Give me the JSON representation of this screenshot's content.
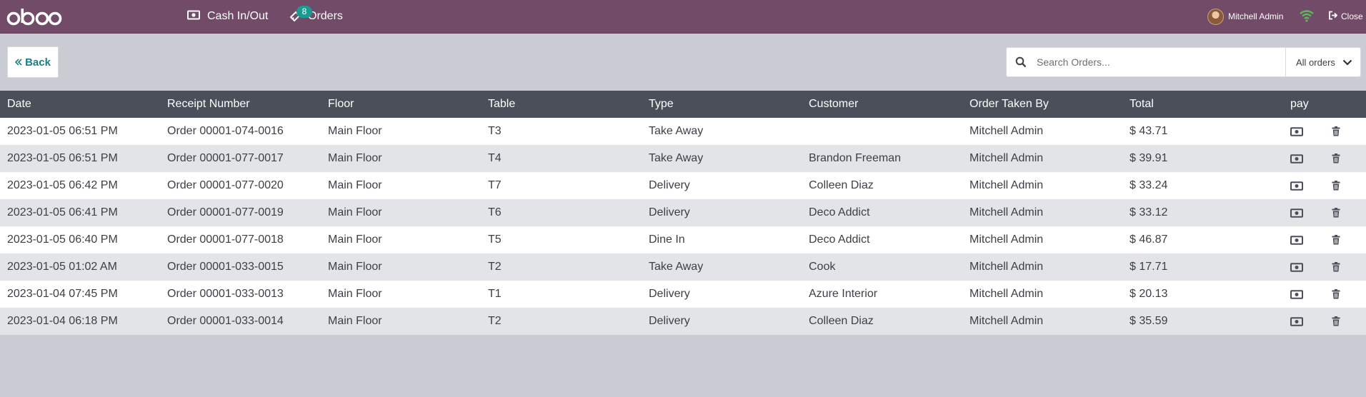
{
  "navbar": {
    "logo_text": "odoo",
    "cash_label": "Cash In/Out",
    "orders_label": "Orders",
    "orders_count": "8",
    "user_name": "Mitchell Admin",
    "close_label": "Close",
    "colors": {
      "background": "#714b67",
      "badge": "#1c9a8f",
      "wifi": "#5cb85c"
    }
  },
  "controls": {
    "back_label": "Back",
    "search_placeholder": "Search Orders...",
    "filter_label": "All orders"
  },
  "table": {
    "headers": [
      "Date",
      "Receipt Number",
      "Floor",
      "Table",
      "Type",
      "Customer",
      "Order Taken By",
      "Total",
      "pay"
    ],
    "rows": [
      {
        "date": "2023-01-05 06:51 PM",
        "receipt": "Order 00001-074-0016",
        "floor": "Main Floor",
        "table": "T3",
        "type": "Take Away",
        "customer": "",
        "taken_by": "Mitchell Admin",
        "total": "$ 43.71"
      },
      {
        "date": "2023-01-05 06:51 PM",
        "receipt": "Order 00001-077-0017",
        "floor": "Main Floor",
        "table": "T4",
        "type": "Take Away",
        "customer": "Brandon Freeman",
        "taken_by": "Mitchell Admin",
        "total": "$ 39.91"
      },
      {
        "date": "2023-01-05 06:42 PM",
        "receipt": "Order 00001-077-0020",
        "floor": "Main Floor",
        "table": "T7",
        "type": "Delivery",
        "customer": "Colleen Diaz",
        "taken_by": "Mitchell Admin",
        "total": "$ 33.24"
      },
      {
        "date": "2023-01-05 06:41 PM",
        "receipt": "Order 00001-077-0019",
        "floor": "Main Floor",
        "table": "T6",
        "type": "Delivery",
        "customer": "Deco Addict",
        "taken_by": "Mitchell Admin",
        "total": "$ 33.12"
      },
      {
        "date": "2023-01-05 06:40 PM",
        "receipt": "Order 00001-077-0018",
        "floor": "Main Floor",
        "table": "T5",
        "type": "Dine In",
        "customer": "Deco Addict",
        "taken_by": "Mitchell Admin",
        "total": "$ 46.87"
      },
      {
        "date": "2023-01-05 01:02 AM",
        "receipt": "Order 00001-033-0015",
        "floor": "Main Floor",
        "table": "T2",
        "type": "Take Away",
        "customer": "Cook",
        "taken_by": "Mitchell Admin",
        "total": "$ 17.71"
      },
      {
        "date": "2023-01-04 07:45 PM",
        "receipt": "Order 00001-033-0013",
        "floor": "Main Floor",
        "table": "T1",
        "type": "Delivery",
        "customer": "Azure Interior",
        "taken_by": "Mitchell Admin",
        "total": "$ 20.13"
      },
      {
        "date": "2023-01-04 06:18 PM",
        "receipt": "Order 00001-033-0014",
        "floor": "Main Floor",
        "table": "T2",
        "type": "Delivery",
        "customer": "Colleen Diaz",
        "taken_by": "Mitchell Admin",
        "total": "$ 35.59"
      }
    ],
    "row_icons": [
      "money-icon",
      "trash-icon"
    ]
  }
}
